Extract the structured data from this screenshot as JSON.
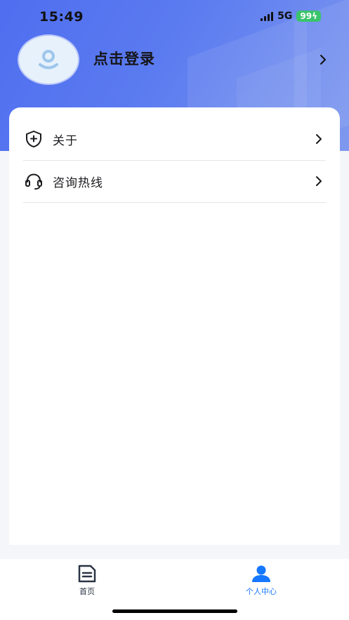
{
  "status_bar": {
    "time": "15:49",
    "network": "5G",
    "battery": "99"
  },
  "profile": {
    "login_label": "点击登录"
  },
  "menu": {
    "items": [
      {
        "label": "关于",
        "icon": "shield-plus-icon"
      },
      {
        "label": "咨询热线",
        "icon": "headset-icon"
      }
    ]
  },
  "tabbar": {
    "tabs": [
      {
        "label": "首页",
        "icon": "document-icon",
        "active": false
      },
      {
        "label": "个人中心",
        "icon": "user-icon",
        "active": true
      }
    ]
  },
  "colors": {
    "accent": "#4f6ef0",
    "active_tab": "#1677ff",
    "inactive_tab": "#2b3444",
    "battery": "#3ac46b"
  }
}
